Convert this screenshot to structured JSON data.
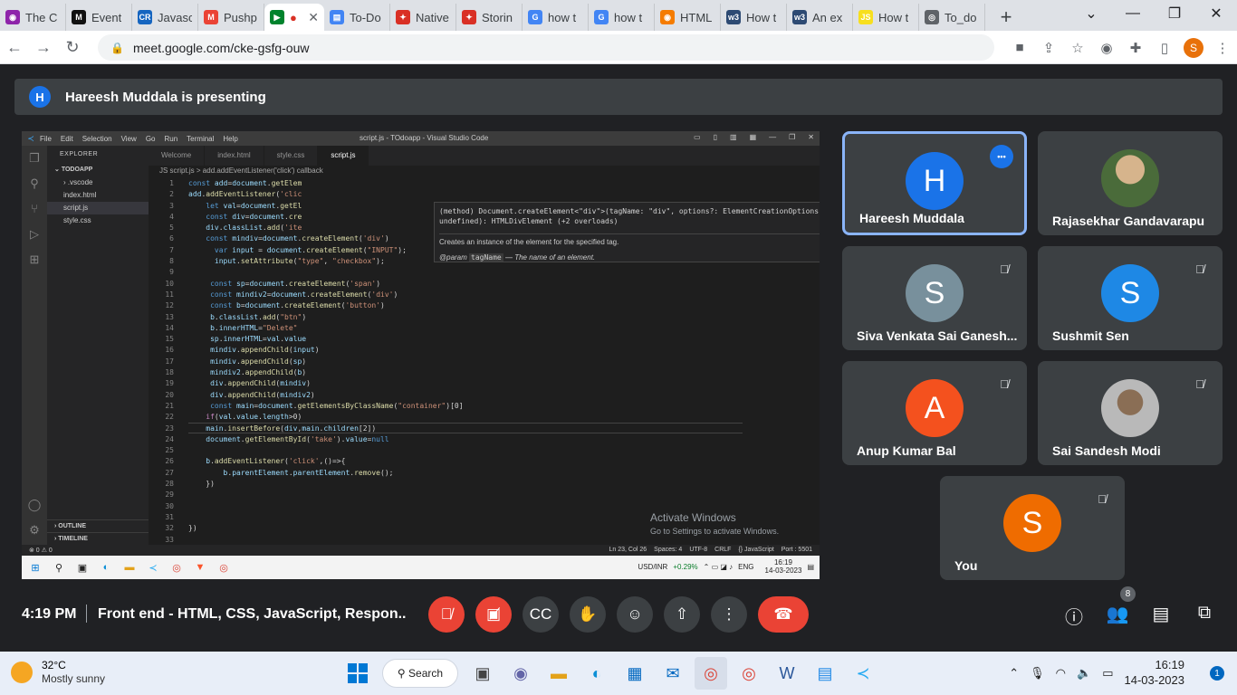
{
  "browser": {
    "tabs": [
      {
        "label": "The C",
        "color": "#8e24aa",
        "glyph": "◉"
      },
      {
        "label": "Event",
        "color": "#111111",
        "glyph": "M"
      },
      {
        "label": "Javasc",
        "color": "#1565c0",
        "glyph": "CR"
      },
      {
        "label": "Pushp",
        "color": "#ea4335",
        "glyph": "M"
      },
      {
        "label": "",
        "color": "#00832d",
        "glyph": "▶",
        "active": true,
        "recording": "●"
      },
      {
        "label": "To-Do",
        "color": "#4285f4",
        "glyph": "▤"
      },
      {
        "label": "Native",
        "color": "#d93025",
        "glyph": "✦"
      },
      {
        "label": "Storin",
        "color": "#d93025",
        "glyph": "✦"
      },
      {
        "label": "how t",
        "color": "#4285f4",
        "glyph": "G"
      },
      {
        "label": "how t",
        "color": "#4285f4",
        "glyph": "G"
      },
      {
        "label": "HTML",
        "color": "#f57c00",
        "glyph": "◉"
      },
      {
        "label": "How t",
        "color": "#2d4a73",
        "glyph": "w3"
      },
      {
        "label": "An ex",
        "color": "#2d4a73",
        "glyph": "w3"
      },
      {
        "label": "How t",
        "color": "#f7df1e",
        "glyph": "JS"
      },
      {
        "label": "To_do",
        "color": "#5f6368",
        "glyph": "◎"
      }
    ],
    "new_tab": "+",
    "window_controls": [
      "⌄",
      "—",
      "❐",
      "✕"
    ],
    "url": "meet.google.com/cke-gsfg-ouw"
  },
  "meet": {
    "presenter_initial": "H",
    "presenting_text": "Hareesh Muddala is presenting",
    "time": "4:19 PM",
    "meeting_title": "Front end - HTML, CSS, JavaScript, Respon...",
    "participant_count": "8",
    "participants": [
      {
        "name": "Hareesh Muddala",
        "initial": "H",
        "color": "#1a73e8",
        "speaking": true
      },
      {
        "name": "Rajasekhar Gandavarapu",
        "initial": "",
        "photo": true
      },
      {
        "name": "Siva Venkata Sai Ganesh...",
        "initial": "S",
        "color": "#78909c",
        "muted": true
      },
      {
        "name": "Sushmit Sen",
        "initial": "S",
        "color": "#1e88e5",
        "muted": true
      },
      {
        "name": "Anup Kumar Bal",
        "initial": "A",
        "color": "#f4511e",
        "muted": true
      },
      {
        "name": "Sai Sandesh Modi",
        "initial": "",
        "photo": true,
        "muted": true
      },
      {
        "name": "You",
        "initial": "S",
        "color": "#ef6c00",
        "muted": true
      }
    ]
  },
  "vscode": {
    "menu": [
      "File",
      "Edit",
      "Selection",
      "View",
      "Go",
      "Run",
      "Terminal",
      "Help"
    ],
    "window_title": "script.js - TOdoapp - Visual Studio Code",
    "explorer_title": "EXPLORER",
    "project": "TODOAPP",
    "files": [
      ".vscode",
      "index.html",
      "script.js",
      "style.css"
    ],
    "outline": "OUTLINE",
    "timeline": "TIMELINE",
    "tabs": [
      "Welcome",
      "index.html",
      "style.css",
      "script.js"
    ],
    "breadcrumb": "JS script.js > add.addEventListener('click') callback",
    "hover_signature": "(method) Document.createElement<\"div\">(tagName: \"div\", options?: ElementCreationOptions | undefined): HTMLDivElement (+2 overloads)",
    "hover_desc": "Creates an instance of the element for the specified tag.",
    "hover_param_label": "@param",
    "hover_param_name": "tagName",
    "hover_param_desc": "— The name of an element.",
    "status_left": "⊗ 0 ⚠ 0",
    "status_right": [
      "Ln 23, Col 26",
      "Spaces: 4",
      "UTF-8",
      "CRLF",
      "{} JavaScript",
      "Port : 5501"
    ],
    "activate_title": "Activate Windows",
    "activate_sub": "Go to Settings to activate Windows.",
    "inner_taskbar": {
      "ticker": "USD/INR",
      "change": "+0.29%",
      "lang": "ENG",
      "time": "16:19",
      "date": "14-03-2023"
    }
  },
  "taskbar": {
    "temp": "32°C",
    "weather": "Mostly sunny",
    "search": "Search",
    "time": "16:19",
    "date": "14-03-2023",
    "notifications": "1"
  }
}
